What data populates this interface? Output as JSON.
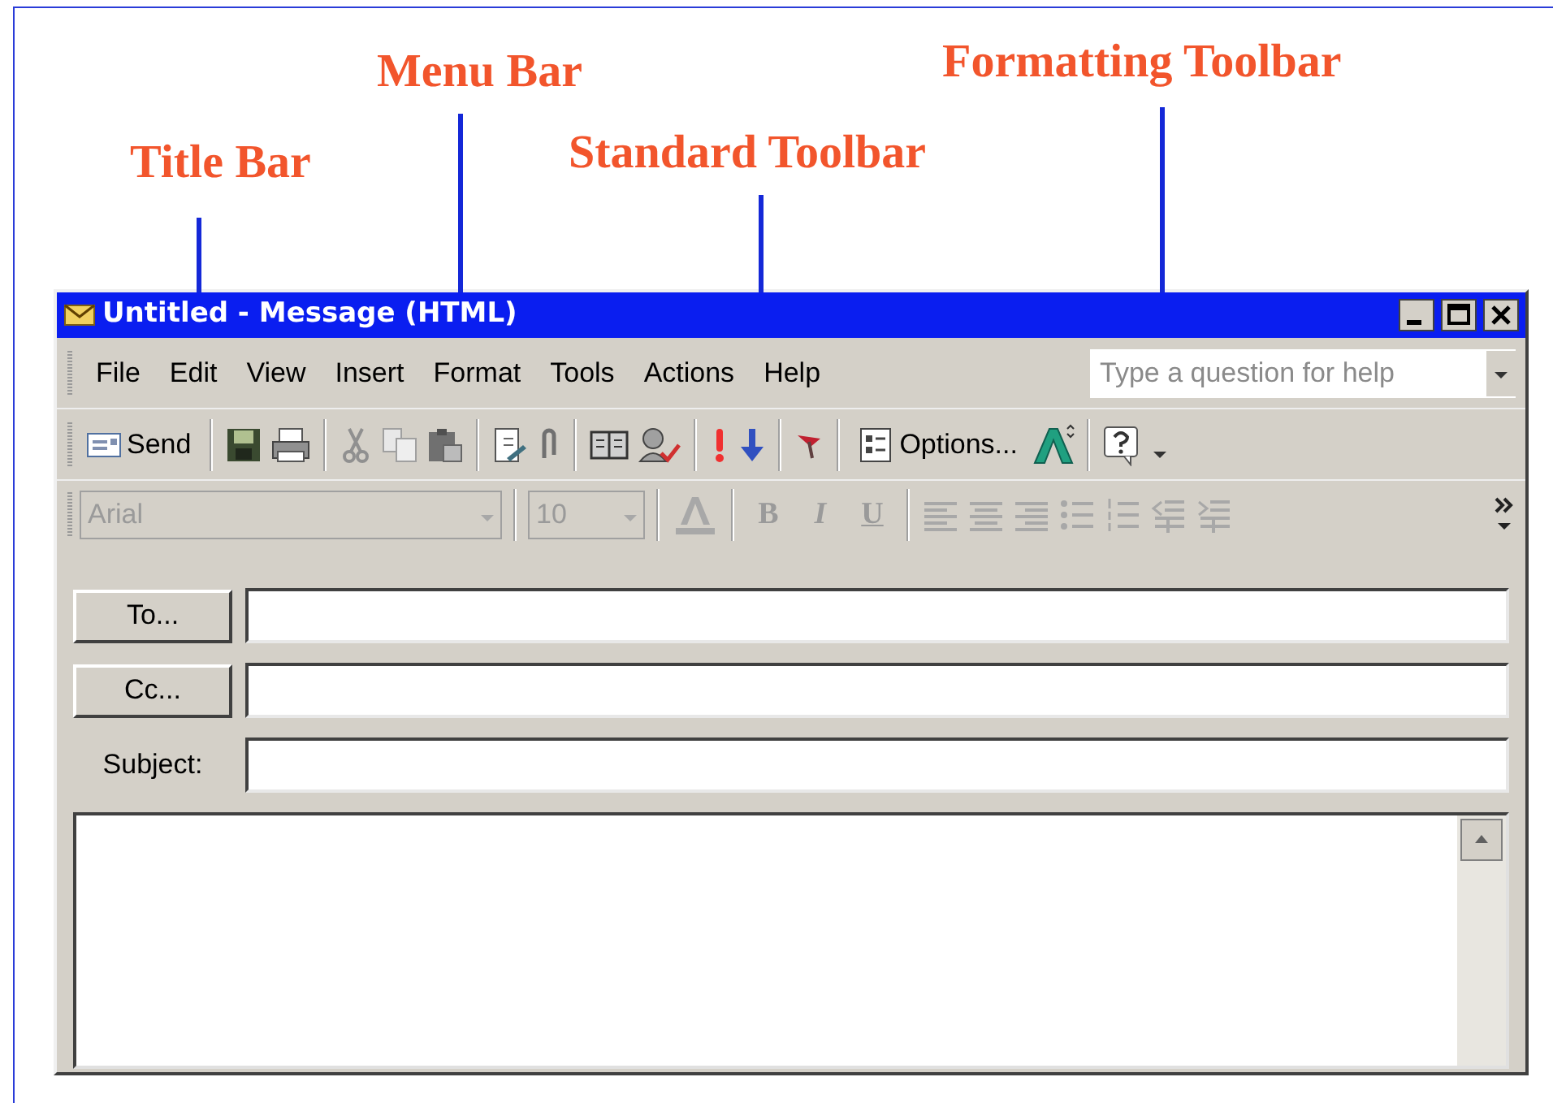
{
  "callouts": [
    {
      "label": "Title Bar"
    },
    {
      "label": "Menu Bar"
    },
    {
      "label": "Standard Toolbar"
    },
    {
      "label": "Formatting Toolbar"
    }
  ],
  "window": {
    "title": "Untitled - Message (HTML)"
  },
  "menu_bar": {
    "items": [
      "File",
      "Edit",
      "View",
      "Insert",
      "Format",
      "Tools",
      "Actions",
      "Help"
    ],
    "help_box": {
      "placeholder": "Type a question for help"
    }
  },
  "standard_toolbar": {
    "send_label": "Send",
    "options_label": "Options..."
  },
  "formatting_toolbar": {
    "disabled": true,
    "font": "Arial",
    "size": "10",
    "style_buttons": [
      "B",
      "I",
      "U"
    ]
  },
  "header_fields": [
    {
      "kind": "button",
      "label": "To..."
    },
    {
      "kind": "button",
      "label": "Cc..."
    },
    {
      "kind": "label",
      "label": "Subject:"
    }
  ]
}
